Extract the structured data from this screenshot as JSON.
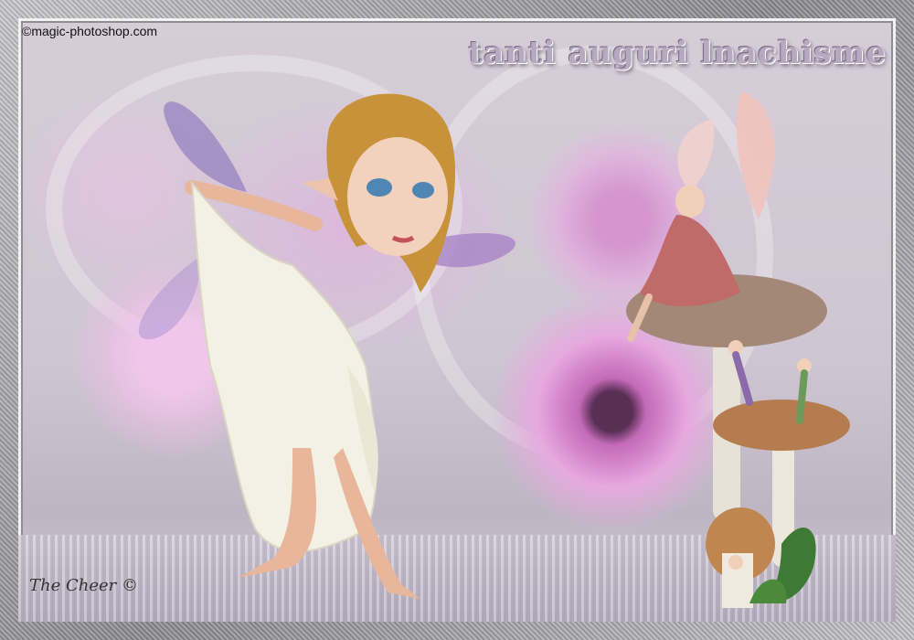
{
  "watermark": {
    "text": "©magic-photoshop.com"
  },
  "title": {
    "text": "tanti auguri lnachisme"
  },
  "signature": {
    "text": "The Cheer ©"
  },
  "colors": {
    "frame": "#9a9a9a",
    "background": "#d6cdd8",
    "flower_pink": "#d98fd3",
    "dress": "#f3f0e4",
    "hair": "#c8923a"
  }
}
